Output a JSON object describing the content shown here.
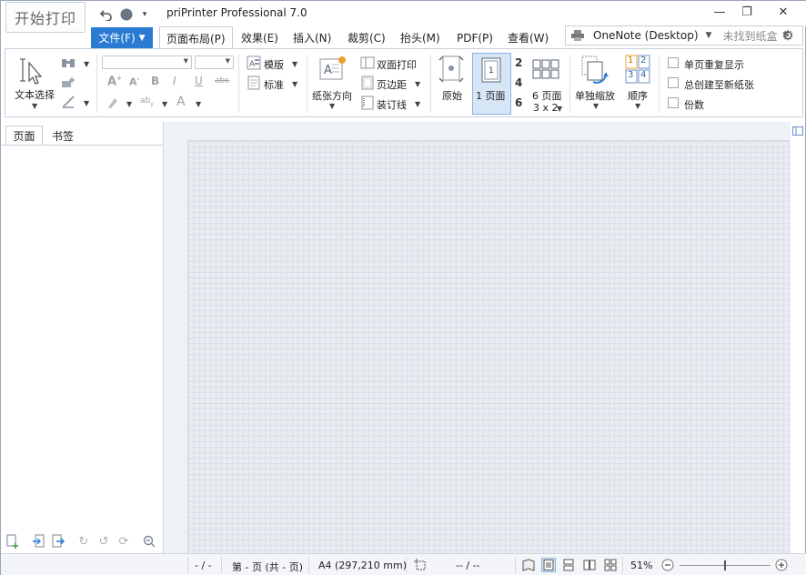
{
  "app": {
    "title": "priPrinter Professional 7.0",
    "start_button": "开始打印"
  },
  "window_controls": {
    "minimize": "—",
    "restore": "❐",
    "close": "✕"
  },
  "menu": {
    "file_label": "文件(F)",
    "tabs": [
      {
        "label": "页面布局(P)",
        "active": true
      },
      {
        "label": "效果(E)",
        "active": false
      },
      {
        "label": "插入(N)",
        "active": false
      },
      {
        "label": "裁剪(C)",
        "active": false
      },
      {
        "label": "抬头(M)",
        "active": false
      },
      {
        "label": "PDF(P)",
        "active": false
      },
      {
        "label": "查看(W)",
        "active": false
      }
    ]
  },
  "printer": {
    "name": "OneNote (Desktop)",
    "tray_status": "未找到纸盒"
  },
  "ribbon": {
    "text_select": "文本选择",
    "template": "模版",
    "standard": "标准",
    "paper_orientation": "纸张方向",
    "duplex": "双面打印",
    "margins": "页边距",
    "binding": "装订线",
    "original": "原始",
    "one_page": "1 页面",
    "n2": "2",
    "n4": "4",
    "n6": "6",
    "six_pages": "6 页面",
    "grid_3x2": "3 x 2",
    "single_scale": "单独缩放",
    "order": "顺序",
    "order_nums": [
      "1",
      "2",
      "3",
      "4"
    ],
    "opt_repeat": "单页重复显示",
    "opt_new_sheet": "总创建至新纸张",
    "opt_copies": "份数"
  },
  "left_panel": {
    "tabs": [
      "页面",
      "书签"
    ],
    "active_tab": "页面"
  },
  "status": {
    "page_nav": "- / -",
    "page_info": "第 - 页 (共 - 页)",
    "paper_size": "A4 (297,210 mm)",
    "sheets": "-- / --",
    "zoom": "51%"
  },
  "colors": {
    "accent": "#2b7bd3",
    "selected_bg": "#d6e6f7",
    "paper_bg": "#e9edf2"
  }
}
